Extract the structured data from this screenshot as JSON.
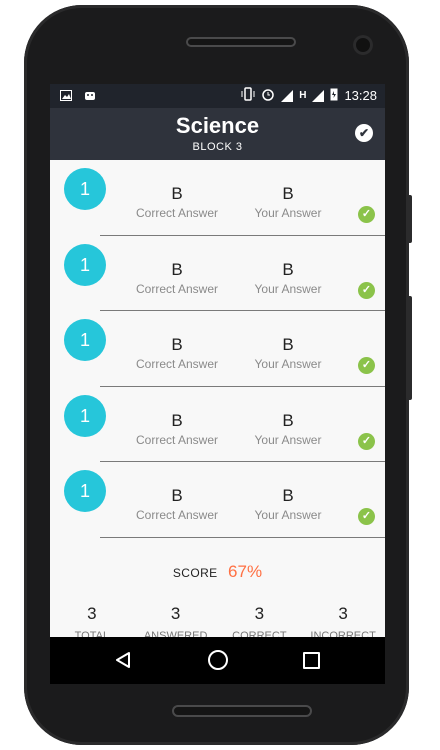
{
  "status_bar": {
    "time": "13:28",
    "network_letter": "H",
    "left_icons": [
      "image-icon",
      "android-icon"
    ],
    "right_icons": [
      "vibrate-icon",
      "alarm-icon",
      "signal-icon",
      "signal-icon",
      "battery-charging-icon"
    ]
  },
  "app_bar": {
    "title": "Science",
    "subtitle": "BLOCK 3",
    "action_icon": "check-circle-icon"
  },
  "questions": [
    {
      "number": "1",
      "correct_answer": "B",
      "correct_label": "Correct Answer",
      "your_answer": "B",
      "your_label": "Your Answer",
      "status_icon": "check-circle-icon"
    },
    {
      "number": "1",
      "correct_answer": "B",
      "correct_label": "Correct Answer",
      "your_answer": "B",
      "your_label": "Your Answer",
      "status_icon": "check-circle-icon"
    },
    {
      "number": "1",
      "correct_answer": "B",
      "correct_label": "Correct Answer",
      "your_answer": "B",
      "your_label": "Your Answer",
      "status_icon": "check-circle-icon"
    },
    {
      "number": "1",
      "correct_answer": "B",
      "correct_label": "Correct Answer",
      "your_answer": "B",
      "your_label": "Your Answer",
      "status_icon": "check-circle-icon"
    },
    {
      "number": "1",
      "correct_answer": "B",
      "correct_label": "Correct Answer",
      "your_answer": "B",
      "your_label": "Your Answer",
      "status_icon": "check-circle-icon"
    }
  ],
  "score": {
    "label": "SCORE",
    "value": "67%"
  },
  "stats": [
    {
      "value": "3",
      "label": "TOTAL"
    },
    {
      "value": "3",
      "label": "ANSWERED"
    },
    {
      "value": "3",
      "label": "CORRECT"
    },
    {
      "value": "3",
      "label": "INCORRECT"
    }
  ],
  "nav_bar": {
    "icons": [
      "back-icon",
      "home-icon",
      "recents-icon"
    ]
  },
  "colors": {
    "accent_circle": "#26c6da",
    "success": "#8bc34a",
    "score": "#ff7043",
    "app_bar": "#2f333c"
  }
}
